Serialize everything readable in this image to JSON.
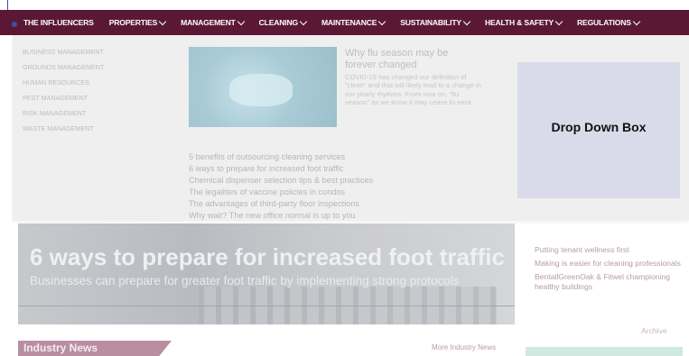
{
  "nav": {
    "items": [
      {
        "label": "THE INFLUENCERS",
        "caret": false
      },
      {
        "label": "PROPERTIES",
        "caret": true
      },
      {
        "label": "MANAGEMENT",
        "caret": true
      },
      {
        "label": "CLEANING",
        "caret": true
      },
      {
        "label": "MAINTENANCE",
        "caret": true
      },
      {
        "label": "SUSTAINABILITY",
        "caret": true
      },
      {
        "label": "HEALTH & SAFETY",
        "caret": true
      },
      {
        "label": "REGULATIONS",
        "caret": true
      }
    ]
  },
  "dropdown": {
    "categories": [
      "BUSINESS MANAGEMENT",
      "GROUNDS MANAGEMENT",
      "HUMAN RESOURCES",
      "PEST MANAGEMENT",
      "RISK MANAGEMENT",
      "WASTE MANAGEMENT"
    ],
    "feature": {
      "title": "Why flu season may be forever changed",
      "text": "COVID-19 has changed our definition of \"clean\" and that will likely lead to a change in our yearly rhythms. From now on, \"flu season\" as we know it may cease to exist."
    },
    "articles": [
      "5 benefits of outsourcing cleaning services",
      "6 ways to prepare for increased foot traffic",
      "Chemical dispenser selection tips & best practices",
      "The legalities of vaccine policies in condos",
      "The advantages of third-party floor inspections",
      "Why wait? The new office normal is up to you"
    ],
    "annotation": "Drop Down Box"
  },
  "hero": {
    "title": "6 ways to prepare for increased foot traffic",
    "subtitle": "Businesses can prepare for greater foot traffic by implementing strong protocols"
  },
  "sidebar": {
    "links": [
      "Putting tenant wellness first",
      "Making is easier for cleaning professionals",
      "BentallGreenOak & Fitwel championing healthy buildings"
    ],
    "archive": "Archive"
  },
  "industry": {
    "heading": "Industry News",
    "more": "More Industry News"
  },
  "colors": {
    "nav_bg": "#5b1834",
    "dropdown_bg": "#efefef",
    "annotation_box": "#d9dbeb",
    "accent": "#3d4fa8"
  }
}
